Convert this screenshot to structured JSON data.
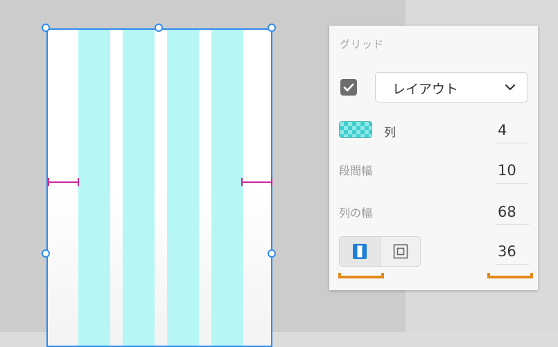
{
  "colors": {
    "canvas": "#cccccc",
    "selection": "#2d8ceb",
    "grid_column": "#b6f7f6",
    "margin_marker": "#c7279e",
    "highlight_bracket": "#e28a1c"
  },
  "panel": {
    "title": "グリッド",
    "enabled": true,
    "grid_type": {
      "selected": "レイアウト",
      "icon": "chevron-down-icon"
    },
    "columns": {
      "label": "列",
      "value": "4",
      "swatch_color": "#8fe9e8"
    },
    "gutter": {
      "label": "段間幅",
      "value": "10"
    },
    "column_width": {
      "label": "列の幅",
      "value": "68"
    },
    "margin": {
      "value": "36",
      "modes": [
        {
          "name": "linked-margins",
          "icon": "linked-margin-icon",
          "active": true
        },
        {
          "name": "different-margins",
          "icon": "different-margin-icon",
          "active": false
        }
      ]
    }
  },
  "artboard": {
    "columns": 4
  }
}
